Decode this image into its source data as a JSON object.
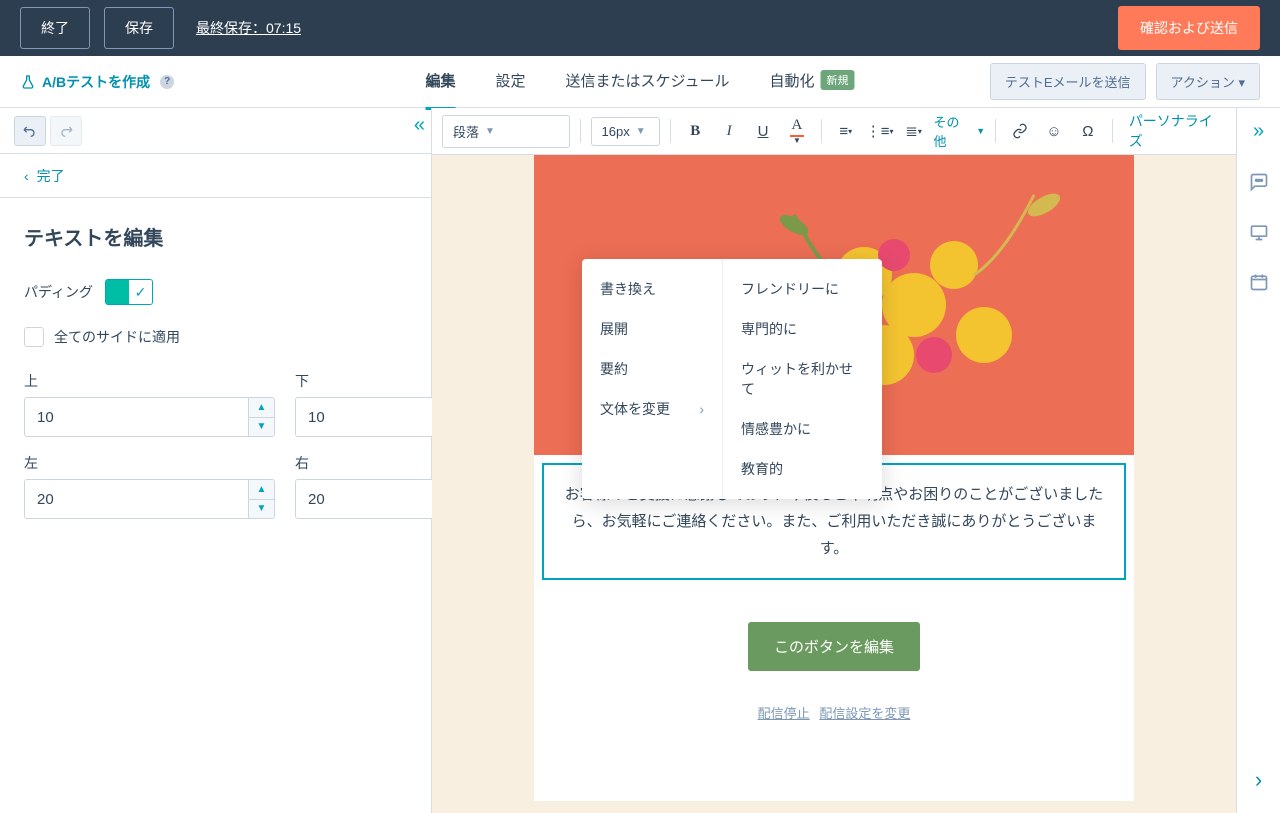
{
  "topbar": {
    "exit": "終了",
    "save": "保存",
    "last_saved": "最終保存：07:15",
    "confirm_send": "確認および送信"
  },
  "subnav": {
    "ab_test": "A/Bテストを作成",
    "tabs": {
      "edit": "編集",
      "settings": "設定",
      "send_schedule": "送信またはスケジュール",
      "automation": "自動化",
      "automation_badge": "新規"
    },
    "test_email": "テストEメールを送信",
    "actions": "アクション"
  },
  "panel": {
    "back": "完了",
    "title": "テキストを編集",
    "padding_label": "パディング",
    "apply_all": "全てのサイドに適用",
    "top": {
      "label": "上",
      "value": "10"
    },
    "bottom": {
      "label": "下",
      "value": "10"
    },
    "left": {
      "label": "左",
      "value": "20"
    },
    "right": {
      "label": "右",
      "value": "20"
    }
  },
  "toolbar": {
    "paragraph": "段落",
    "fontsize": "16px",
    "more": "その他",
    "personalize": "パーソナライズ"
  },
  "email": {
    "body_text": "お客様のご支援に感謝しており、今後もご不明点やお困りのことがございましたら、お気軽にご連絡ください。また、ご利用いただき誠にありがとうございます。",
    "cta": "このボタンを編集",
    "unsubscribe": "配信停止",
    "change_settings": "配信設定を変更"
  },
  "context_menu": {
    "left": [
      "書き換え",
      "展開",
      "要約",
      "文体を変更"
    ],
    "right": [
      "フレンドリーに",
      "専門的に",
      "ウィットを利かせて",
      "情感豊かに",
      "教育的"
    ]
  }
}
